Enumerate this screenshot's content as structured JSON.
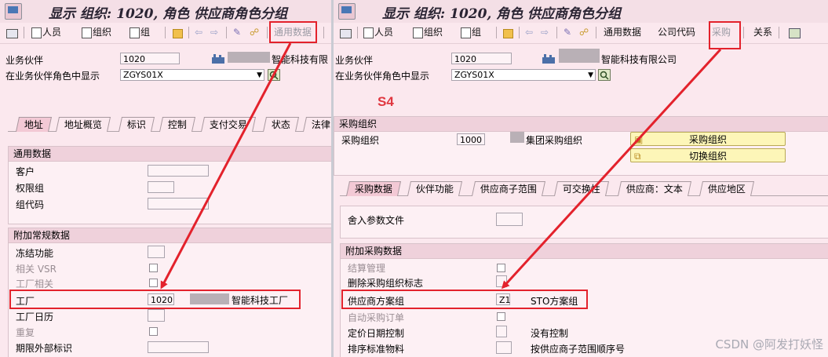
{
  "left": {
    "title": "显示 组织: 1020, 角色 供应商角色分组",
    "toolbar": [
      "人员",
      "组织",
      "组",
      "通用数据"
    ],
    "bp_label": "业务伙伴",
    "bp_value": "1020",
    "bp_name": "智能科技有限",
    "role_label": "在业务伙伴角色中显示",
    "role_value": "ZGYS01X",
    "tabs": [
      "地址",
      "地址概览",
      "标识",
      "控制",
      "支付交易",
      "状态",
      "法律"
    ],
    "group1_title": "通用数据",
    "group1_rows": [
      "客户",
      "权限组",
      "组代码"
    ],
    "group2_title": "附加常规数据",
    "group2_rows": [
      "冻结功能",
      "相关 VSR",
      "工厂相关",
      "工厂",
      "工厂日历",
      "重复",
      "期限外部标识"
    ],
    "plant_value": "1020",
    "plant_name": "智能科技工厂"
  },
  "right": {
    "title": "显示 组织: 1020, 角色 供应商角色分组",
    "toolbar": [
      "人员",
      "组织",
      "组",
      "通用数据",
      "公司代码",
      "采购",
      "关系"
    ],
    "bp_label": "业务伙伴",
    "bp_value": "1020",
    "bp_name": "智能科技有限公司",
    "role_label": "在业务伙伴角色中显示",
    "role_value": "ZGYS01X",
    "s4_label": "S4",
    "purch_org_group": "采购组织",
    "purch_org_label": "采购组织",
    "purch_org_value": "1000",
    "purch_org_name": "集团采购组织",
    "btn_purch_org": "采购组织",
    "btn_switch_org": "切换组织",
    "tabs": [
      "采购数据",
      "伙伴功能",
      "供应商子范围",
      "可交换性",
      "供应商：文本",
      "供应地区"
    ],
    "rounding_label": "舍入参数文件",
    "group_title": "附加采购数据",
    "rows": [
      "结算管理",
      "删除采购组织标志",
      "供应商方案组",
      "自动采购订单",
      "定价日期控制",
      "排序标准物料"
    ],
    "schema_value": "Z1",
    "schema_text": "STO方案组",
    "pricing_text": "没有控制",
    "sort_text": "按供应商子范围顺序号"
  },
  "watermark": "CSDN @阿发打妖怪"
}
